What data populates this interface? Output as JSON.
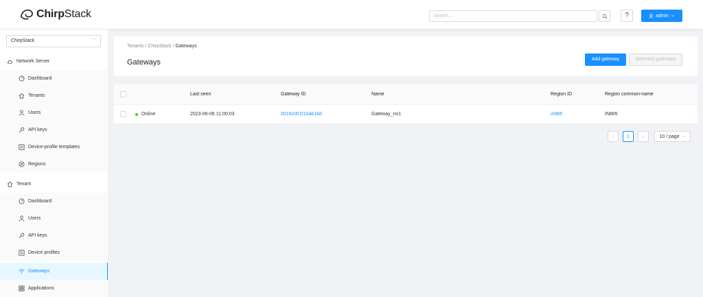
{
  "header": {
    "logo_text_bold": "Chirp",
    "logo_text_rest": "Stack",
    "search_placeholder": "Search...",
    "help_label": "?",
    "user_label": "admin"
  },
  "sidebar": {
    "tenant_selected": "ChirpStack",
    "network_server_label": "Network Server",
    "network_items": [
      {
        "label": "Dashboard",
        "icon": "dashboard-icon"
      },
      {
        "label": "Tenants",
        "icon": "home-icon"
      },
      {
        "label": "Users",
        "icon": "user-icon"
      },
      {
        "label": "API keys",
        "icon": "key-icon"
      },
      {
        "label": "Device-profile templates",
        "icon": "profile-icon"
      },
      {
        "label": "Regions",
        "icon": "compass-icon"
      }
    ],
    "tenant_label": "Tenant",
    "tenant_items": [
      {
        "label": "Dashboard",
        "icon": "dashboard-icon"
      },
      {
        "label": "Users",
        "icon": "user-icon"
      },
      {
        "label": "API keys",
        "icon": "key-icon"
      },
      {
        "label": "Device profiles",
        "icon": "profile-icon"
      },
      {
        "label": "Gateways",
        "icon": "wifi-icon",
        "active": true
      },
      {
        "label": "Applications",
        "icon": "apps-icon"
      }
    ]
  },
  "page": {
    "breadcrumb": [
      "Tenants",
      "ChirpStack",
      "Gateways"
    ],
    "title": "Gateways",
    "add_button": "Add gateway",
    "selected_button": "Selected gateways"
  },
  "table": {
    "columns": [
      "Last seen",
      "Gateway ID",
      "Name",
      "Region ID",
      "Region common-name"
    ],
    "rows": [
      {
        "status": "Online",
        "last_seen": "2023-06-06 11:00:03",
        "gateway_id": "0016c001f10ab16d",
        "name": "Gateway_no1",
        "region_id": "in865",
        "region_common_name": "IN865"
      }
    ]
  },
  "pagination": {
    "current_page": "1",
    "page_size": "10 / page"
  },
  "colors": {
    "primary": "#1890ff",
    "online": "#52c41a"
  }
}
